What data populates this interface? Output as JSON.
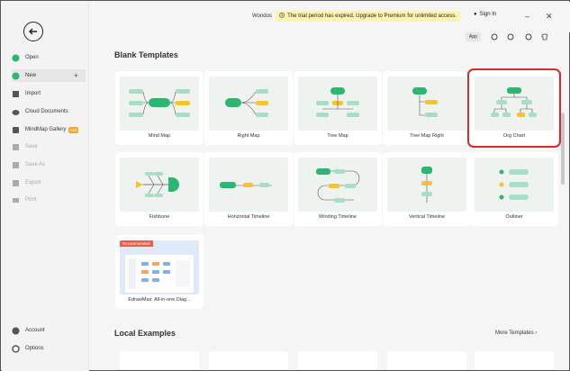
{
  "colors": {
    "green": "#2bb673",
    "light_green": "#a8ddc6",
    "yellow": "#f7c32e",
    "selected_border": "#d92b2b",
    "trial_bg": "#fff3b0"
  },
  "sidebar": {
    "items": [
      {
        "label": "Open",
        "icon": "folder-icon"
      },
      {
        "label": "New",
        "icon": "new-icon"
      },
      {
        "label": "Import",
        "icon": "import-icon"
      },
      {
        "label": "Cloud Documents",
        "icon": "cloud-icon"
      },
      {
        "label": "MindMap Gallery",
        "icon": "gallery-icon",
        "badge": "Hot"
      },
      {
        "label": "Save",
        "icon": "save-icon"
      },
      {
        "label": "Save As",
        "icon": "save-as-icon"
      },
      {
        "label": "Export",
        "icon": "export-icon"
      },
      {
        "label": "Print",
        "icon": "print-icon"
      }
    ],
    "bottom": [
      {
        "label": "Account",
        "icon": "account-icon"
      },
      {
        "label": "Options",
        "icon": "options-icon"
      }
    ]
  },
  "topbar": {
    "brand": "Wondos",
    "trial_text": "The trial period has expired. Upgrade to Premium for unlimited access.",
    "signin": "Sign In",
    "app_label": "App"
  },
  "main": {
    "blank_title": "Blank Templates",
    "templates": [
      {
        "name": "Mind Map"
      },
      {
        "name": "Right Map"
      },
      {
        "name": "Tree Map"
      },
      {
        "name": "Tree Map Right"
      },
      {
        "name": "Org Chart"
      },
      {
        "name": "Fishbone"
      },
      {
        "name": "Horizontal Timeline"
      },
      {
        "name": "Winding Timeline"
      },
      {
        "name": "Vertical Timeline"
      },
      {
        "name": "Outliner"
      },
      {
        "name": "EdrawMax: All-in-one Diag...",
        "badge": "Recommended"
      }
    ],
    "local_title": "Local Examples",
    "more_templates": "More Templates"
  }
}
